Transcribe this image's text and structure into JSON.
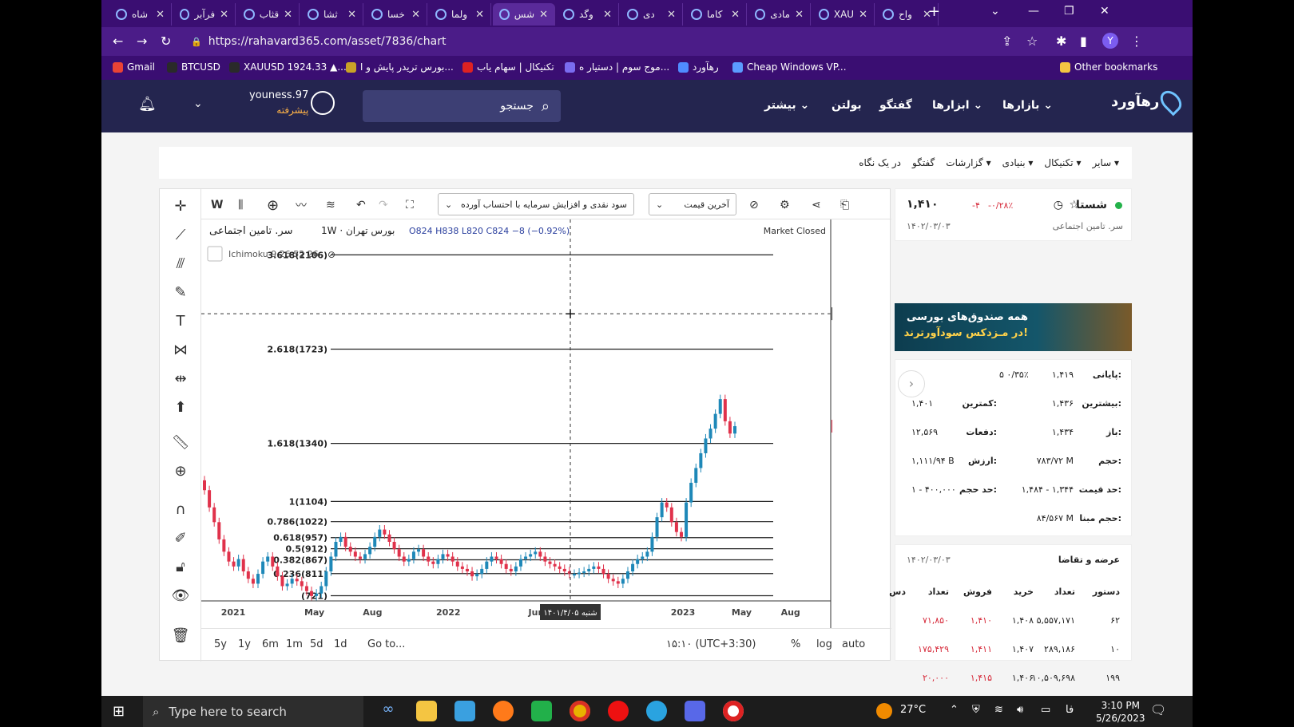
{
  "browser": {
    "tabs": [
      {
        "label": "شاه",
        "active": false
      },
      {
        "label": "فرآبر",
        "active": false
      },
      {
        "label": "قثاب",
        "active": false
      },
      {
        "label": "ثشا",
        "active": false
      },
      {
        "label": "خسا",
        "active": false
      },
      {
        "label": "ولما",
        "active": false
      },
      {
        "label": "شس",
        "active": true
      },
      {
        "label": "وگد",
        "active": false
      },
      {
        "label": "دی",
        "active": false
      },
      {
        "label": "کاما",
        "active": false
      },
      {
        "label": "مادی",
        "active": false
      },
      {
        "label": "XAU",
        "active": false
      },
      {
        "label": "واح",
        "active": false
      }
    ],
    "url": "https://rahavard365.com/asset/7836/chart",
    "bookmarks": [
      {
        "label": "Gmail"
      },
      {
        "label": "BTCUSD"
      },
      {
        "label": "XAUUSD 1924.33 ▲..."
      },
      {
        "label": "بورس تریدر پایش و ا..."
      },
      {
        "label": "تکنیکال | سهام یاب"
      },
      {
        "label": "موج سوم | دستیار ه..."
      },
      {
        "label": "رهآورد"
      },
      {
        "label": "Cheap Windows VP..."
      }
    ],
    "other_bookmarks": "Other bookmarks"
  },
  "site": {
    "logo": "رهآورد",
    "menu": [
      "بازارها",
      "ابزارها",
      "گفتگو",
      "بولتن",
      "بیشتر"
    ],
    "search_placeholder": "جستجو",
    "user_name": "youness.97",
    "user_level": "پیشرفته"
  },
  "subnav": [
    "در یک نگاه",
    "گفتگو",
    "گزارشات ▾",
    "بنیادی ▾",
    "تکنیکال ▾",
    "سایر ▾"
  ],
  "chart_toolbar": {
    "interval": "W",
    "price_type": "آخرین قیمت",
    "adjust": "سود نقدی و افزایش سرمایه با احتساب آورده",
    "legend_name": "سر. تامین اجتماعی",
    "legend_mid": "1W · بورس تهران",
    "ohlc": "O824  H838  L820  C824  −8 (−0.92%)",
    "indicator": "Ichimoku 9 26 52 26",
    "market_status": "Market Closed",
    "crosshair_price": "1867",
    "last_price_tag": "1410",
    "crosshair_date": "شنبه ۱۴۰۱/۴/۰۵"
  },
  "chart_data": {
    "type": "candlestick",
    "title": "سر. تامین اجتماعی",
    "interval": "1W",
    "ylim": [
      700,
      2250
    ],
    "y_ticks": [
      800,
      1000,
      1200,
      1400,
      1600,
      1800,
      2000,
      2200
    ],
    "x_ticks": [
      {
        "label": "2021",
        "t": 0.0
      },
      {
        "label": "May",
        "t": 0.166
      },
      {
        "label": "Aug",
        "t": 0.285
      },
      {
        "label": "2022",
        "t": 0.44
      },
      {
        "label": "Jun",
        "t": 0.62
      },
      {
        "label": "2023",
        "t": 0.92
      },
      {
        "label": "May",
        "t": 1.04
      },
      {
        "label": "Aug",
        "t": 1.14
      }
    ],
    "fib_levels": [
      {
        "label": "3.618(2106)",
        "value": 2106
      },
      {
        "label": "2.618(1723)",
        "value": 1723
      },
      {
        "label": "1.618(1340)",
        "value": 1340
      },
      {
        "label": "1(1104)",
        "value": 1104
      },
      {
        "label": "0.786(1022)",
        "value": 1022
      },
      {
        "label": "0.618(957)",
        "value": 957
      },
      {
        "label": "0.5(912)",
        "value": 912
      },
      {
        "label": "0.382(867)",
        "value": 867
      },
      {
        "label": "0.236(811)",
        "value": 811
      },
      {
        "label": "(721)",
        "value": 721
      }
    ],
    "closes": [
      1150,
      1080,
      1020,
      950,
      900,
      860,
      840,
      870,
      820,
      790,
      770,
      810,
      860,
      880,
      840,
      800,
      760,
      770,
      790,
      780,
      760,
      740,
      720,
      730,
      760,
      820,
      880,
      940,
      960,
      920,
      900,
      880,
      870,
      890,
      920,
      960,
      990,
      970,
      940,
      910,
      880,
      860,
      870,
      900,
      910,
      880,
      860,
      850,
      870,
      890,
      880,
      860,
      840,
      830,
      820,
      800,
      810,
      830,
      860,
      880,
      870,
      850,
      830,
      820,
      840,
      870,
      880,
      890,
      900,
      880,
      860,
      850,
      840,
      830,
      820,
      810,
      810,
      815,
      820,
      830,
      840,
      830,
      810,
      790,
      780,
      770,
      790,
      820,
      850,
      870,
      880,
      900,
      960,
      1040,
      1100,
      1080,
      1020,
      980,
      960,
      1100,
      1180,
      1240,
      1300,
      1360,
      1400,
      1460,
      1520,
      1430,
      1380,
      1410
    ]
  },
  "range_buttons": [
    "5y",
    "1y",
    "6m",
    "1m",
    "5d",
    "1d"
  ],
  "goto_label": "Go to...",
  "timezone": "۱۵:۱۰ (UTC+3:30)",
  "scale_buttons": [
    "%",
    "log",
    "auto"
  ],
  "symbol": {
    "name": "شستا",
    "full_name": "سر. تامین اجتماعی",
    "price": "۱,۴۱۰",
    "change": "-۴",
    "change_pct": "-۰/۲۸٪",
    "date": "۱۴۰۲/۰۳/۰۳",
    "status_color": "#24b24a"
  },
  "banner": {
    "line1": "همه صندوق‌های بورسی",
    "line2": "در مـزدکس سودآورترند!"
  },
  "stats": [
    {
      "label": "پایانی:",
      "value": "۱,۴۱۹",
      "extra": "۵  ۰/۳۵٪"
    },
    {
      "label": "بیشترین:",
      "value": "۱,۴۳۶",
      "label2": "کمترین:",
      "value2": "۱,۴۰۱"
    },
    {
      "label": "باز:",
      "value": "۱,۴۳۴",
      "label2": "دفعات:",
      "value2": "۱۲,۵۶۹"
    },
    {
      "label": "حجم:",
      "value": "۷۸۳/۷۲ M",
      "label2": "ارزش:",
      "value2": "۱,۱۱۱/۹۴ B"
    },
    {
      "label": "حد قیمت:",
      "value": "۱,۴۸۴ - ۱,۳۴۴",
      "label2": "حد حجم:",
      "value2": "۱ - ۴۰۰,۰۰۰"
    },
    {
      "label": "حجم مبنا:",
      "value": "۸۴/۵۶۷ M"
    }
  ],
  "orderbook": {
    "title": "عرضه و تقاضا",
    "date": "۱۴۰۲/۰۳/۰۳",
    "headers": [
      "دستور",
      "تعداد",
      "خرید",
      "فروش",
      "تعداد",
      "دس"
    ],
    "rows": [
      [
        "۶۲",
        "۵,۵۵۷,۱۷۱",
        "۱,۴۰۸",
        "۱,۴۱۰",
        "۷۱,۸۵۰"
      ],
      [
        "۱۰",
        "۲۸۹,۱۸۶",
        "۱,۴۰۷",
        "۱,۴۱۱",
        "۱۷۵,۴۲۹"
      ],
      [
        "۱۹۹",
        "۱۰,۵۰۹,۶۹۸",
        "۱,۴۰۶",
        "۱,۴۱۵",
        "۲۰,۰۰۰"
      ]
    ]
  },
  "taskbar": {
    "search_placeholder": "Type here to search",
    "weather": "27°C",
    "lang": "فا",
    "time": "3:10 PM",
    "date": "5/26/2023"
  },
  "colors": {
    "up": "#26a69a",
    "up_fill": "#1e88b8",
    "down": "#e0324b",
    "header": "#24254f",
    "accent": "#6fc3ff"
  }
}
